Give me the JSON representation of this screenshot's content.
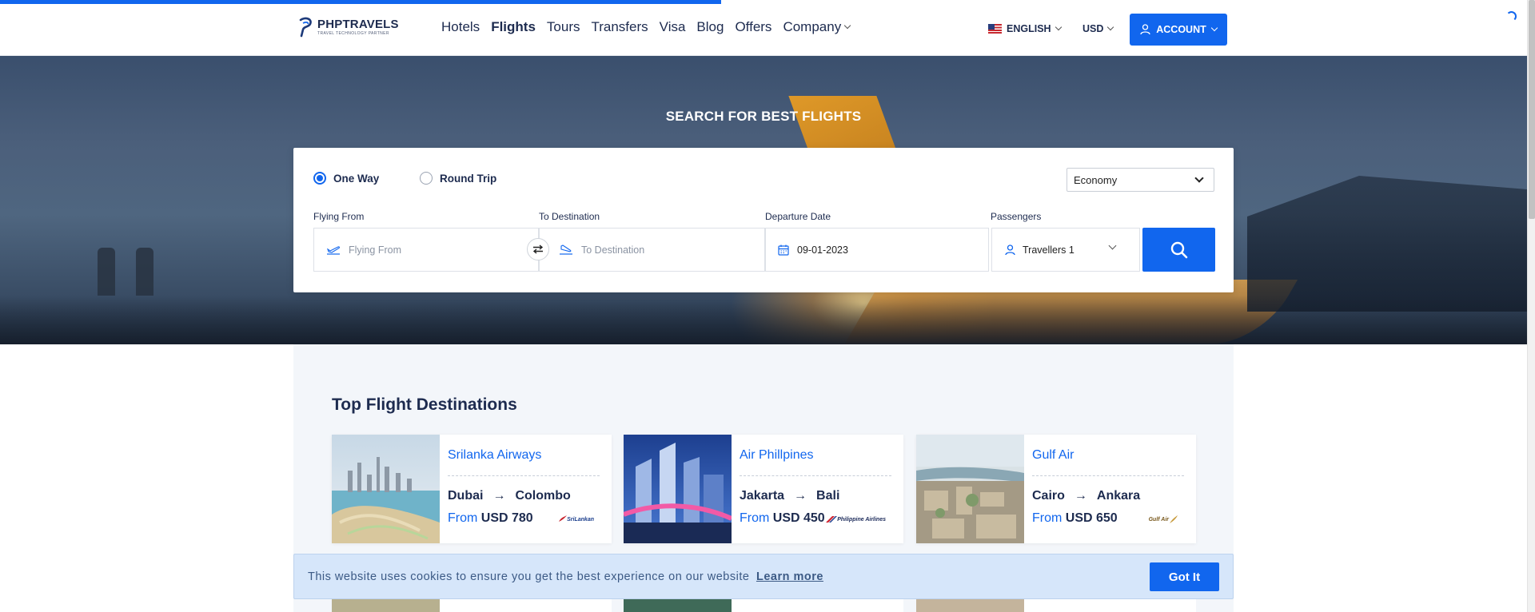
{
  "header": {
    "brand_name": "PHPTRAVELS",
    "brand_tagline": "TRAVEL TECHNOLOGY PARTNER",
    "nav": [
      {
        "label": "Hotels",
        "active": false
      },
      {
        "label": "Flights",
        "active": true
      },
      {
        "label": "Tours",
        "active": false
      },
      {
        "label": "Transfers",
        "active": false
      },
      {
        "label": "Visa",
        "active": false
      },
      {
        "label": "Blog",
        "active": false
      },
      {
        "label": "Offers",
        "active": false
      },
      {
        "label": "Company",
        "active": false
      }
    ],
    "language": "ENGLISH",
    "currency": "USD",
    "account_label": "ACCOUNT"
  },
  "hero": {
    "title": "SEARCH FOR BEST FLIGHTS"
  },
  "search": {
    "trip_types": [
      {
        "label": "One Way",
        "selected": true
      },
      {
        "label": "Round Trip",
        "selected": false
      }
    ],
    "cabin_class": "Economy",
    "flying_from_label": "Flying From",
    "flying_from_placeholder": "Flying From",
    "to_label": "To Destination",
    "to_placeholder": "To Destination",
    "date_label": "Departure Date",
    "date_value": "09-01-2023",
    "passengers_label": "Passengers",
    "passengers_value": "Travellers 1"
  },
  "destinations": {
    "title": "Top Flight Destinations",
    "cards": [
      {
        "airline": "Srilanka Airways",
        "from": "Dubai",
        "to": "Colombo",
        "price_prefix": "From",
        "price": "USD 780",
        "logo_text": "SriLankan"
      },
      {
        "airline": "Air Phillpines",
        "from": "Jakarta",
        "to": "Bali",
        "price_prefix": "From",
        "price": "USD 450",
        "logo_text": "Philippine Airlines"
      },
      {
        "airline": "Gulf Air",
        "from": "Cairo",
        "to": "Ankara",
        "price_prefix": "From",
        "price": "USD 650",
        "logo_text": "Gulf Air"
      }
    ]
  },
  "cookie": {
    "message": "This website uses cookies to ensure you get the best experience on our website",
    "link_label": "Learn more",
    "button_label": "Got It"
  },
  "colors": {
    "accent": "#1166ee",
    "navy": "#1d2b4f",
    "cookie_bg": "#d6e6fa"
  }
}
